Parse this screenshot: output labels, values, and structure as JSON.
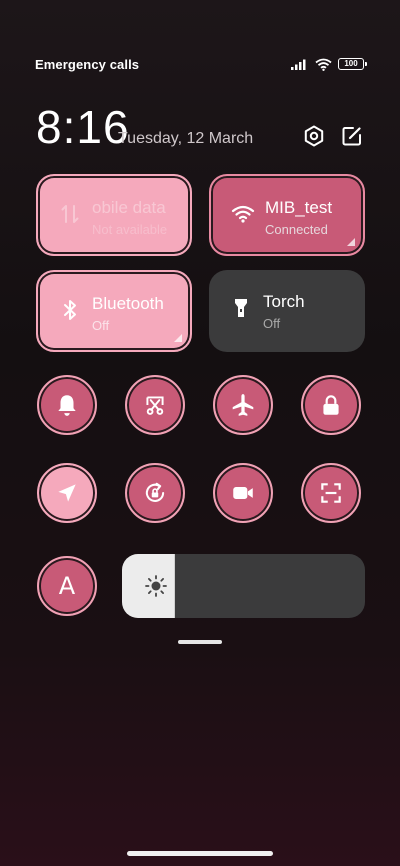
{
  "status_bar": {
    "carrier_text": "Emergency calls o",
    "battery_level": "100",
    "icons": [
      "signal-icon",
      "wifi-icon",
      "battery-icon"
    ]
  },
  "header": {
    "time": "8:16",
    "date": "Tuesday, 12 March",
    "icons": [
      "settings-icon",
      "edit-icon"
    ]
  },
  "tiles": [
    {
      "id": "mobile-data",
      "title": "obile data",
      "subtitle": "Not available",
      "icon": "mobile-data-icon",
      "state": "unavailable"
    },
    {
      "id": "wifi",
      "title": "MIB_test",
      "subtitle": "Connected",
      "icon": "wifi-icon",
      "state": "on"
    },
    {
      "id": "bluetooth",
      "title": "Bluetooth",
      "subtitle": "Off",
      "icon": "bluetooth-icon",
      "state": "off"
    },
    {
      "id": "torch",
      "title": "Torch",
      "subtitle": "Off",
      "icon": "torch-icon",
      "state": "off"
    }
  ],
  "toggles": [
    {
      "id": "ring-mode",
      "icon": "bell-icon"
    },
    {
      "id": "screenshot",
      "icon": "scissors-icon"
    },
    {
      "id": "airplane-mode",
      "icon": "airplane-icon"
    },
    {
      "id": "lock-screen",
      "icon": "lock-icon"
    },
    {
      "id": "location",
      "icon": "location-arrow-icon"
    },
    {
      "id": "rotation-lock",
      "icon": "rotation-lock-icon"
    },
    {
      "id": "screen-recorder",
      "icon": "video-camera-icon"
    },
    {
      "id": "scanner",
      "icon": "scan-icon"
    },
    {
      "id": "auto-brightness",
      "icon": "letter-a-icon",
      "label": "A"
    }
  ],
  "brightness": {
    "level": 0.22,
    "icon": "sun-icon"
  },
  "colors": {
    "accent": "#c85a77",
    "accent_light": "#f5a9bc",
    "tile_off": "#3b3b3c"
  }
}
